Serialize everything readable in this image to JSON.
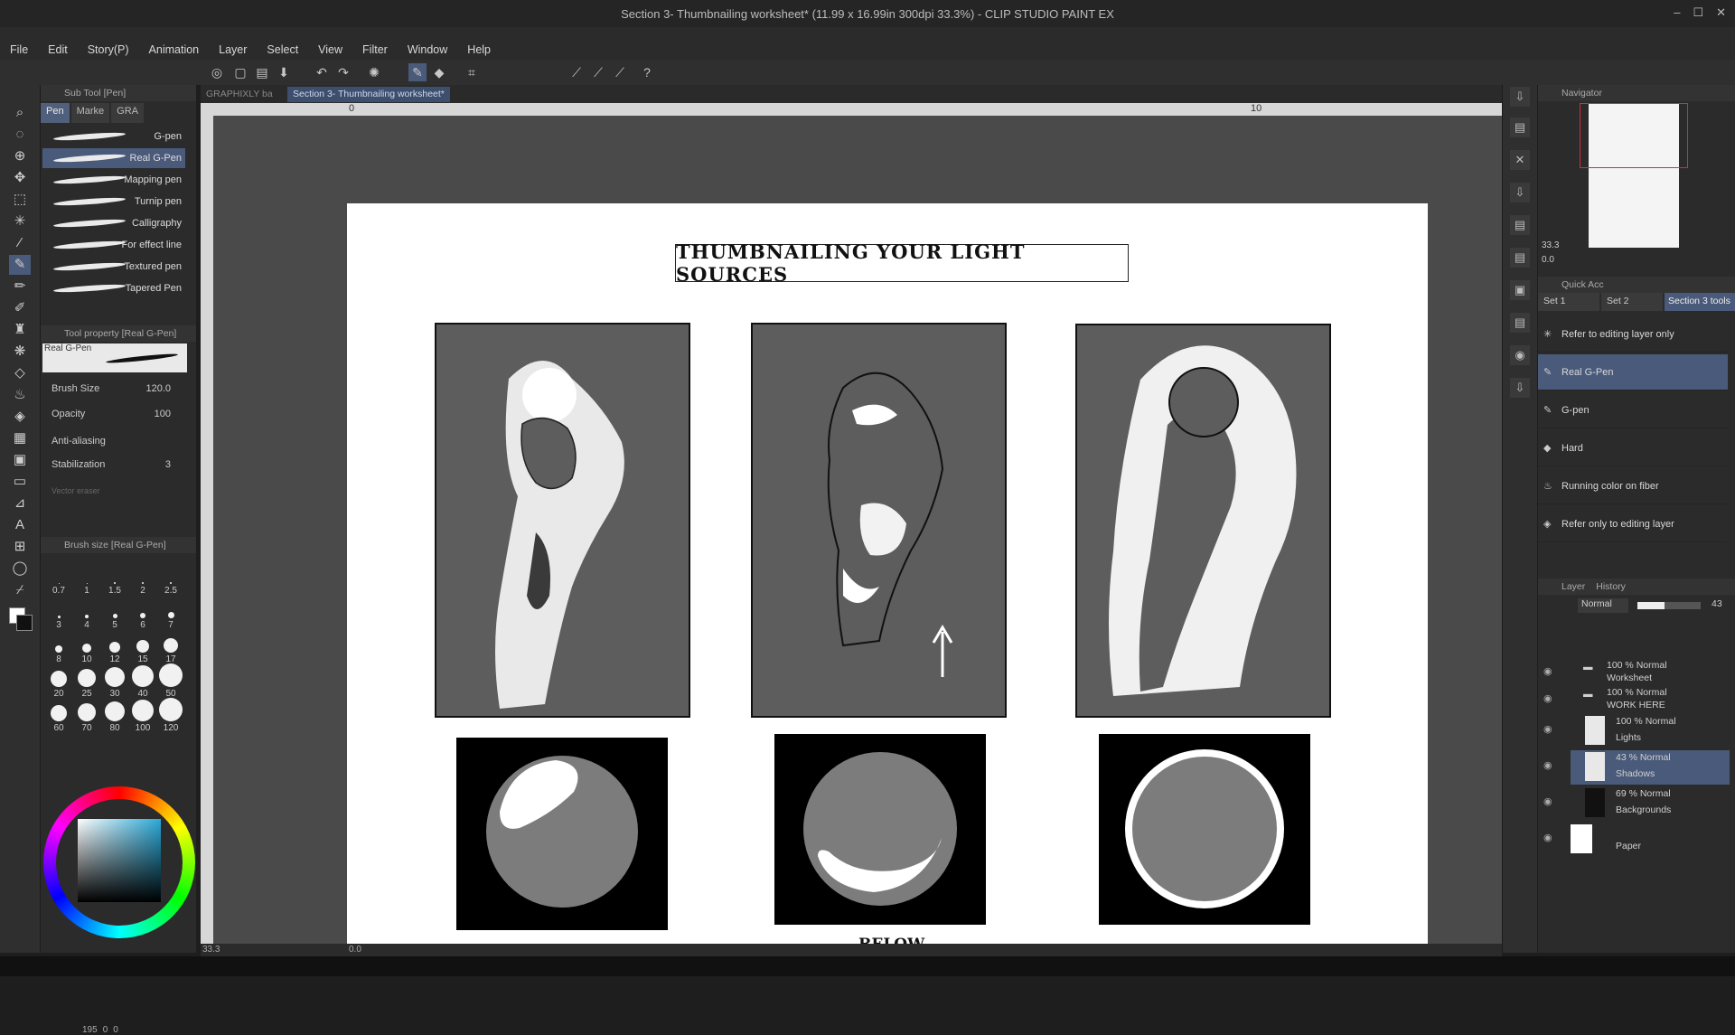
{
  "window": {
    "title": "Section 3- Thumbnailing worksheet* (11.99 x 16.99in 300dpi 33.3%) - CLIP STUDIO PAINT EX"
  },
  "menu": [
    "File",
    "Edit",
    "Story(P)",
    "Animation",
    "Layer",
    "Select",
    "View",
    "Filter",
    "Window",
    "Help"
  ],
  "doc_tabs": [
    {
      "label": "GRAPHIXLY ba"
    },
    {
      "label": "Section 3- Thumbnailing worksheet*"
    }
  ],
  "ruler": {
    "left": "0",
    "mid": "10"
  },
  "subtool": {
    "header": "Sub Tool [Pen]",
    "tabs": [
      "Pen",
      "Marke",
      "GRA"
    ],
    "brushes": [
      "G-pen",
      "Real G-Pen",
      "Mapping pen",
      "Turnip pen",
      "Calligraphy",
      "For effect line",
      "Textured pen",
      "Tapered Pen"
    ]
  },
  "toolprop": {
    "header": "Tool property [Real G-Pen]",
    "preview_label": "Real G-Pen",
    "brush_size_label": "Brush Size",
    "brush_size_value": "120.0",
    "opacity_label": "Opacity",
    "opacity_value": "100",
    "antialias_label": "Anti-aliasing",
    "stabilization_label": "Stabilization",
    "stabilization_value": "3",
    "vector_label": "Vector eraser"
  },
  "brushsize": {
    "header": "Brush size [Real G-Pen]",
    "sizes": [
      "0.7",
      "1",
      "1.5",
      "2",
      "2.5",
      "3",
      "4",
      "5",
      "6",
      "7",
      "8",
      "10",
      "12",
      "15",
      "17",
      "20",
      "25",
      "30",
      "40",
      "50",
      "60",
      "70",
      "80",
      "100",
      "120"
    ]
  },
  "color_status": {
    "a": "195",
    "b": "0",
    "c": "0"
  },
  "worksheet": {
    "title": "THUMBNAILING YOUR LIGHT SOURCES",
    "bottom_text": "BELOW"
  },
  "navigator": {
    "header": "Navigator",
    "zoom": "33.3",
    "rotate": "0.0"
  },
  "quick_access": {
    "header": "Quick Acc",
    "sets": [
      "Set 1",
      "Set 2",
      "Section 3 tools"
    ],
    "items": [
      "Refer to editing layer only",
      "Real G-Pen",
      "G-pen",
      "Hard",
      "Running color on fiber",
      "Refer only to editing layer"
    ]
  },
  "layer_panel": {
    "tabs": [
      "Layer",
      "History"
    ],
    "blend": "Normal",
    "opacity": "43",
    "layers": [
      {
        "top": "100 % Normal",
        "name": "Worksheet"
      },
      {
        "top": "100 % Normal",
        "name": "WORK HERE"
      },
      {
        "top": "100 % Normal",
        "name": "Lights"
      },
      {
        "top": "43 % Normal",
        "name": "Shadows"
      },
      {
        "top": "69 % Normal",
        "name": "Backgrounds"
      },
      {
        "top": "",
        "name": "Paper"
      }
    ]
  },
  "statusbar": {
    "zoom": "33.3",
    "angle": "0.0"
  }
}
